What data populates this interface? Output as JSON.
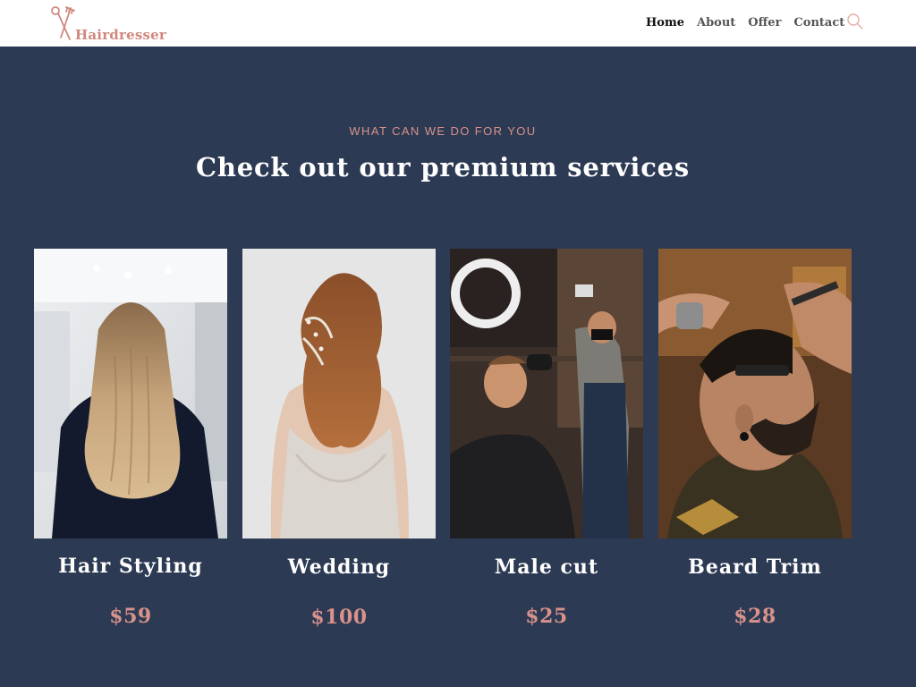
{
  "header": {
    "logo_text": "Hairdresser",
    "nav": [
      {
        "label": "Home"
      },
      {
        "label": "About"
      },
      {
        "label": "Offer"
      },
      {
        "label": "Contact"
      }
    ],
    "search_icon": "search-icon"
  },
  "services": {
    "eyebrow": "WHAT CAN WE DO FOR YOU",
    "title": "Check out our premium services",
    "items": [
      {
        "name": "Hair Styling",
        "price": "$59"
      },
      {
        "name": "Wedding",
        "price": "$100"
      },
      {
        "name": "Male cut",
        "price": "$25"
      },
      {
        "name": "Beard Trim",
        "price": "$28"
      }
    ]
  },
  "colors": {
    "background": "#2c3a54",
    "accent": "#d9928a",
    "header_bg": "#ffffff"
  }
}
